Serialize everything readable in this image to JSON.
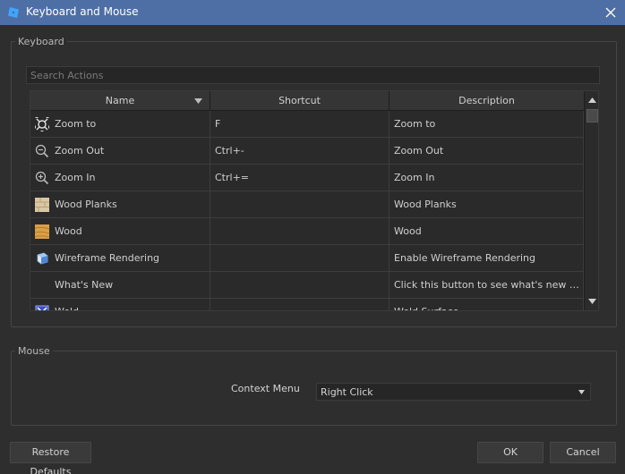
{
  "window": {
    "title": "Keyboard and Mouse",
    "titlebar_color": "#4e6fa5",
    "app_icon": "roblox-studio-icon",
    "close_icon": "close-icon"
  },
  "keyboard": {
    "group_label": "Keyboard",
    "search": {
      "placeholder": "Search Actions",
      "value": ""
    },
    "columns": [
      "Name",
      "Shortcut",
      "Description"
    ],
    "sort_column": "Name",
    "rows": [
      {
        "icon": "zoom-to-icon",
        "name": "Zoom to",
        "shortcut": "F",
        "description": "Zoom to"
      },
      {
        "icon": "zoom-out-icon",
        "name": "Zoom Out",
        "shortcut": "Ctrl+-",
        "description": "Zoom Out"
      },
      {
        "icon": "zoom-in-icon",
        "name": "Zoom In",
        "shortcut": "Ctrl+=",
        "description": "Zoom In"
      },
      {
        "icon": "wood-planks-icon",
        "name": "Wood Planks",
        "shortcut": "",
        "description": "Wood Planks"
      },
      {
        "icon": "wood-icon",
        "name": "Wood",
        "shortcut": "",
        "description": "Wood"
      },
      {
        "icon": "wireframe-icon",
        "name": "Wireframe Rendering",
        "shortcut": "",
        "description": "Enable Wireframe Rendering"
      },
      {
        "icon": "",
        "name": "What's New",
        "shortcut": "",
        "description": "Click this button to see what's new wit..."
      },
      {
        "icon": "weld-icon",
        "name": "Weld",
        "shortcut": "",
        "description": "Weld Surface"
      }
    ]
  },
  "mouse": {
    "group_label": "Mouse",
    "context_menu_label": "Context Menu",
    "context_menu_value": "Right Click"
  },
  "buttons": {
    "restore_defaults": "Restore Defaults",
    "ok": "OK",
    "cancel": "Cancel"
  }
}
